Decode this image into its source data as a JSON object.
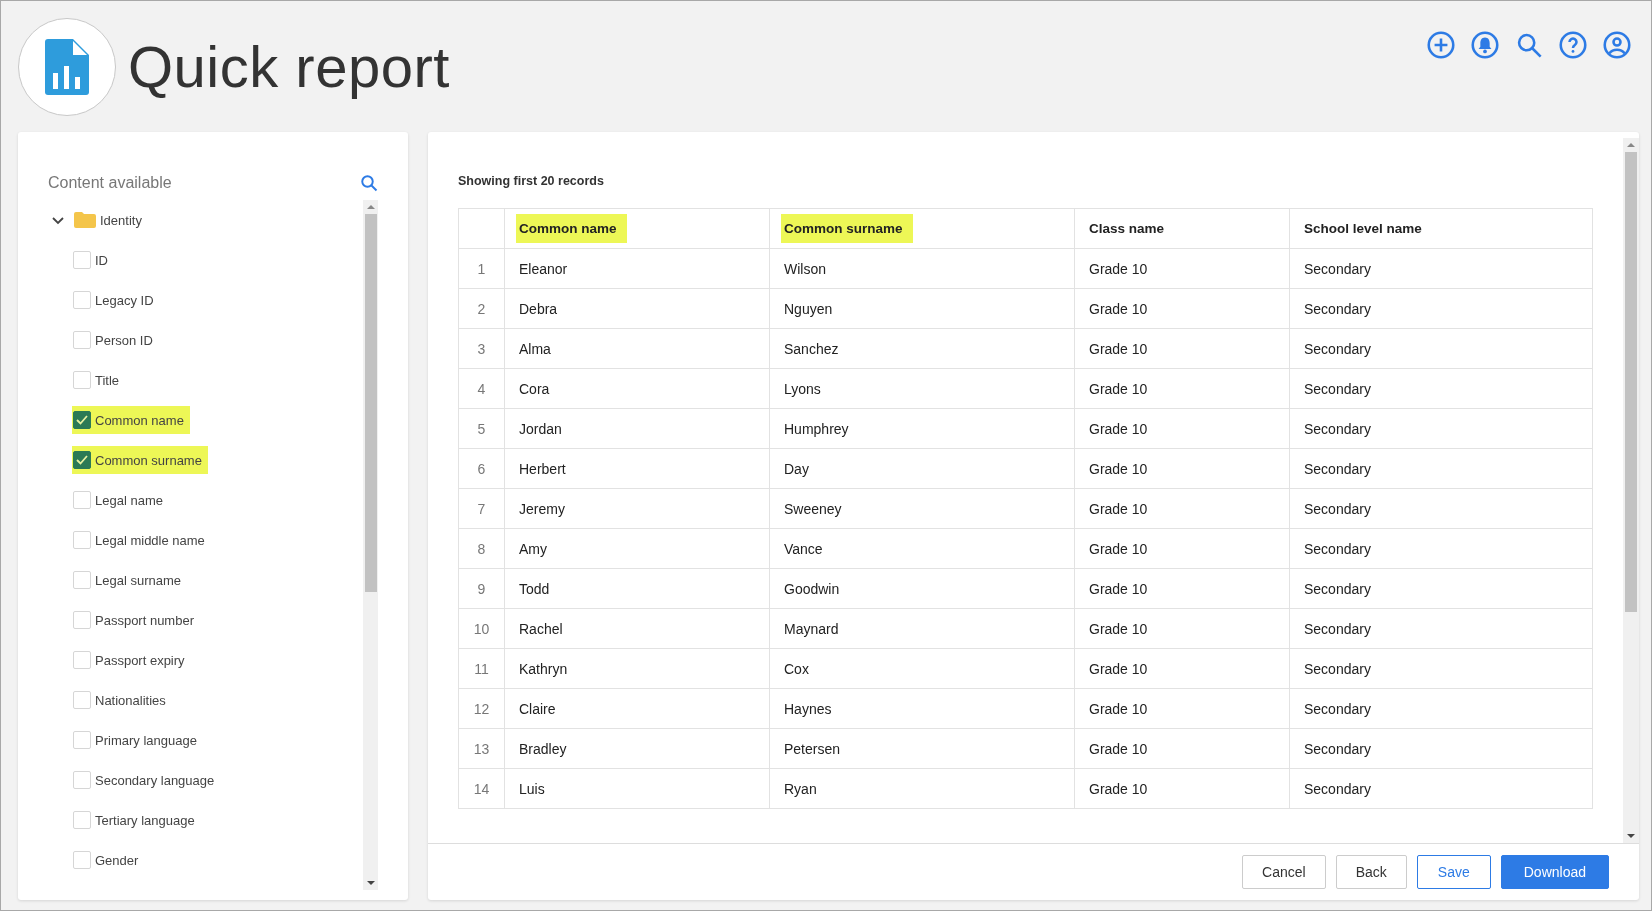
{
  "header": {
    "title": "Quick report"
  },
  "sidebar": {
    "title": "Content available",
    "tree": [
      {
        "label": "Identity",
        "expanded": true,
        "children": [
          {
            "label": "ID",
            "checked": false
          },
          {
            "label": "Legacy ID",
            "checked": false
          },
          {
            "label": "Person ID",
            "checked": false
          },
          {
            "label": "Title",
            "checked": false
          },
          {
            "label": "Common name",
            "checked": true
          },
          {
            "label": "Common surname",
            "checked": true
          },
          {
            "label": "Legal name",
            "checked": false
          },
          {
            "label": "Legal middle name",
            "checked": false
          },
          {
            "label": "Legal surname",
            "checked": false
          },
          {
            "label": "Passport number",
            "checked": false
          },
          {
            "label": "Passport expiry",
            "checked": false
          },
          {
            "label": "Nationalities",
            "checked": false
          },
          {
            "label": "Primary language",
            "checked": false
          },
          {
            "label": "Secondary language",
            "checked": false
          },
          {
            "label": "Tertiary language",
            "checked": false
          },
          {
            "label": "Gender",
            "checked": false
          }
        ]
      }
    ]
  },
  "report": {
    "caption": "Showing first 20 records",
    "columns": [
      {
        "label": "Common name",
        "highlighted": true
      },
      {
        "label": "Common surname",
        "highlighted": true
      },
      {
        "label": "Class name",
        "highlighted": false
      },
      {
        "label": "School level name",
        "highlighted": false
      }
    ],
    "rows": [
      {
        "number": "1",
        "cells": [
          "Eleanor",
          "Wilson",
          "Grade 10",
          "Secondary"
        ]
      },
      {
        "number": "2",
        "cells": [
          "Debra",
          "Nguyen",
          "Grade 10",
          "Secondary"
        ]
      },
      {
        "number": "3",
        "cells": [
          "Alma",
          "Sanchez",
          "Grade 10",
          "Secondary"
        ]
      },
      {
        "number": "4",
        "cells": [
          "Cora",
          "Lyons",
          "Grade 10",
          "Secondary"
        ]
      },
      {
        "number": "5",
        "cells": [
          "Jordan",
          "Humphrey",
          "Grade 10",
          "Secondary"
        ]
      },
      {
        "number": "6",
        "cells": [
          "Herbert",
          "Day",
          "Grade 10",
          "Secondary"
        ]
      },
      {
        "number": "7",
        "cells": [
          "Jeremy",
          "Sweeney",
          "Grade 10",
          "Secondary"
        ]
      },
      {
        "number": "8",
        "cells": [
          "Amy",
          "Vance",
          "Grade 10",
          "Secondary"
        ]
      },
      {
        "number": "9",
        "cells": [
          "Todd",
          "Goodwin",
          "Grade 10",
          "Secondary"
        ]
      },
      {
        "number": "10",
        "cells": [
          "Rachel",
          "Maynard",
          "Grade 10",
          "Secondary"
        ]
      },
      {
        "number": "11",
        "cells": [
          "Kathryn",
          "Cox",
          "Grade 10",
          "Secondary"
        ]
      },
      {
        "number": "12",
        "cells": [
          "Claire",
          "Haynes",
          "Grade 10",
          "Secondary"
        ]
      },
      {
        "number": "13",
        "cells": [
          "Bradley",
          "Petersen",
          "Grade 10",
          "Secondary"
        ]
      },
      {
        "number": "14",
        "cells": [
          "Luis",
          "Ryan",
          "Grade 10",
          "Secondary"
        ]
      }
    ],
    "buttons": [
      {
        "label": "Cancel",
        "kind": "plain"
      },
      {
        "label": "Back",
        "kind": "plain"
      },
      {
        "label": "Save",
        "kind": "outline"
      },
      {
        "label": "Download",
        "kind": "primary"
      }
    ]
  }
}
